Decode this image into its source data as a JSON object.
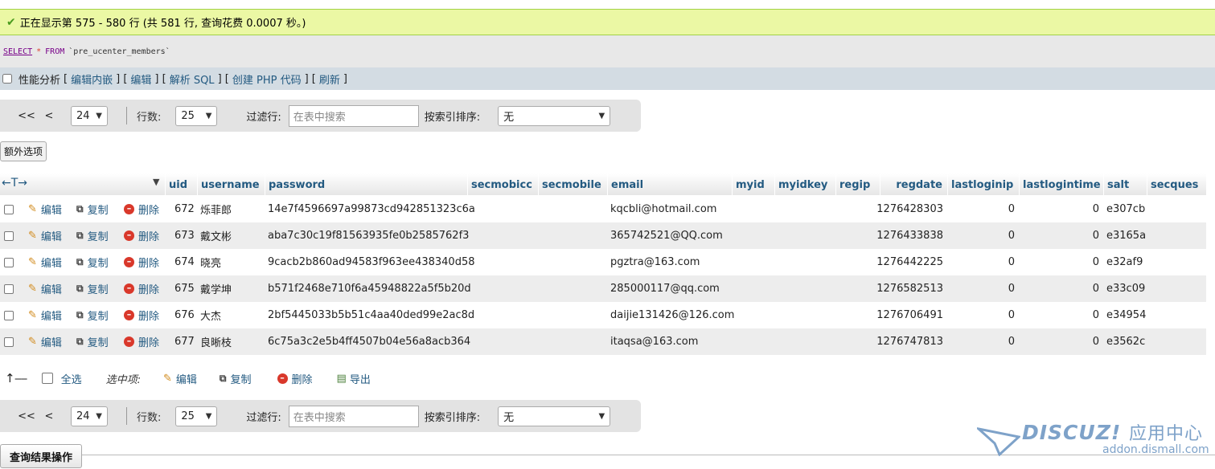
{
  "notice": {
    "icon": "check-icon",
    "text": "正在显示第 575 - 580 行 (共 581 行, 查询花费 0.0007 秒。)"
  },
  "sql": {
    "select": "SELECT",
    "star": "*",
    "from": "FROM",
    "table": "`pre_ucenter_members`"
  },
  "links": {
    "profiling": "性能分析",
    "items": [
      "编辑内嵌",
      "编辑",
      "解析 SQL",
      "创建 PHP 代码",
      "刷新"
    ]
  },
  "nav": {
    "first": "<<",
    "prev": "<",
    "page": "24",
    "rows_label": "行数:",
    "rows": "25",
    "filter_label": "过滤行:",
    "filter_placeholder": "在表中搜索",
    "sort_label": "按索引排序:",
    "sort_value": "无"
  },
  "extra_options": "额外选项",
  "table": {
    "columns": [
      "uid",
      "username",
      "password",
      "secmobicc",
      "secmobile",
      "email",
      "myid",
      "myidkey",
      "regip",
      "regdate",
      "lastloginip",
      "lastlogintime",
      "salt",
      "secques"
    ],
    "actions": {
      "edit": "编辑",
      "copy": "复制",
      "delete": "删除"
    },
    "rows": [
      {
        "uid": "672",
        "username": "烁菲郎",
        "password": "14e7f4596697a99873cd942851323c6a",
        "email": "kqcbli@hotmail.com",
        "regdate": "1276428303",
        "lastloginip": "0",
        "lastlogintime": "0",
        "salt": "e307cb"
      },
      {
        "uid": "673",
        "username": "戴文彬",
        "password": "aba7c30c19f81563935fe0b2585762f3",
        "email": "365742521@QQ.com",
        "regdate": "1276433838",
        "lastloginip": "0",
        "lastlogintime": "0",
        "salt": "e3165a"
      },
      {
        "uid": "674",
        "username": "晓亮",
        "password": "9cacb2b860ad94583f963ee438340d58",
        "email": "pgztra@163.com",
        "regdate": "1276442225",
        "lastloginip": "0",
        "lastlogintime": "0",
        "salt": "e32af9"
      },
      {
        "uid": "675",
        "username": "戴学坤",
        "password": "b571f2468e710f6a45948822a5f5b20d",
        "email": "285000117@qq.com",
        "regdate": "1276582513",
        "lastloginip": "0",
        "lastlogintime": "0",
        "salt": "e33c09"
      },
      {
        "uid": "676",
        "username": "大杰",
        "password": "2bf5445033b5b51c4aa40ded99e2ac8d",
        "email": "daijie131426@126.com",
        "regdate": "1276706491",
        "lastloginip": "0",
        "lastlogintime": "0",
        "salt": "e34954"
      },
      {
        "uid": "677",
        "username": "良晰枝",
        "password": "6c75a3c2e5b4ff4507b04e56a8acb364",
        "email": "itaqsa@163.com",
        "regdate": "1276747813",
        "lastloginip": "0",
        "lastlogintime": "0",
        "salt": "e3562c"
      }
    ]
  },
  "bulk": {
    "select_all": "全选",
    "with_selected": "选中项:",
    "edit": "编辑",
    "copy": "复制",
    "delete": "删除",
    "export": "导出"
  },
  "query_results": "查询结果操作",
  "watermark": {
    "brand": "DISCUZ!",
    "brand_cn": "应用中心",
    "site": "addon.dismall.com"
  },
  "colors": {
    "link": "#235a81",
    "notice_bg": "#ebf8a4",
    "delete": "#d9382b"
  }
}
